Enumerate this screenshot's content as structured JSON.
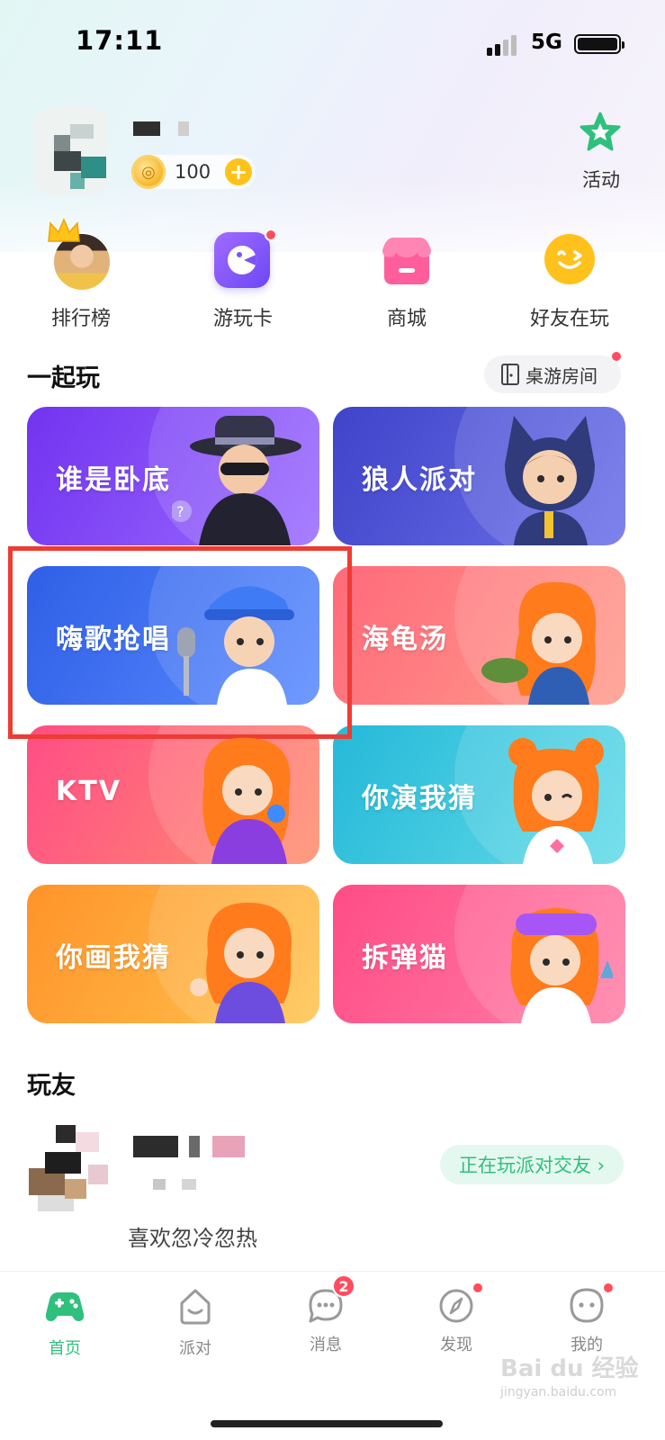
{
  "status_bar": {
    "time": "17:11",
    "network": "5G"
  },
  "profile": {
    "coins": "100",
    "coin_plus": "+"
  },
  "activity": {
    "label": "活动",
    "icon": "star-badge-icon"
  },
  "quick_menu": [
    {
      "label": "排行榜",
      "icon": "crown-avatar-icon"
    },
    {
      "label": "游玩卡",
      "icon": "game-card-icon"
    },
    {
      "label": "商城",
      "icon": "shop-icon"
    },
    {
      "label": "好友在玩",
      "icon": "smiley-icon"
    }
  ],
  "play_section": {
    "title": "一起玩",
    "room_button": "桌游房间"
  },
  "games": [
    {
      "title": "谁是卧底",
      "colors": [
        "#7b3ff2",
        "#9c6bff"
      ]
    },
    {
      "title": "狼人派对",
      "colors": [
        "#4b4fd6",
        "#6a6ee8"
      ]
    },
    {
      "title": "嗨歌抢唱",
      "colors": [
        "#3b6af0",
        "#5c8cff"
      ]
    },
    {
      "title": "海龟汤",
      "colors": [
        "#ff6f7a",
        "#ff9a8a"
      ]
    },
    {
      "title": "KTV",
      "colors": [
        "#ff5a8a",
        "#ff8c6e"
      ]
    },
    {
      "title": "你演我猜",
      "colors": [
        "#2ec0dc",
        "#5fd8e8"
      ]
    },
    {
      "title": "你画我猜",
      "colors": [
        "#ff9a2e",
        "#ffbf4a"
      ]
    },
    {
      "title": "拆弹猫",
      "colors": [
        "#ff4f87",
        "#ff7ea3"
      ]
    }
  ],
  "buddies_section": {
    "title": "玩友"
  },
  "buddy": {
    "status": "喜欢忽冷忽热",
    "action_label": "正在玩派对交友 ›"
  },
  "tabs": [
    {
      "label": "首页",
      "icon": "gamepad-icon",
      "active": true
    },
    {
      "label": "派对",
      "icon": "party-house-icon"
    },
    {
      "label": "消息",
      "icon": "message-icon",
      "badge": "2"
    },
    {
      "label": "发现",
      "icon": "compass-icon"
    },
    {
      "label": "我的",
      "icon": "profile-face-icon"
    }
  ],
  "watermark": {
    "main": "Bai du 经验",
    "sub": "jingyan.baidu.com"
  }
}
